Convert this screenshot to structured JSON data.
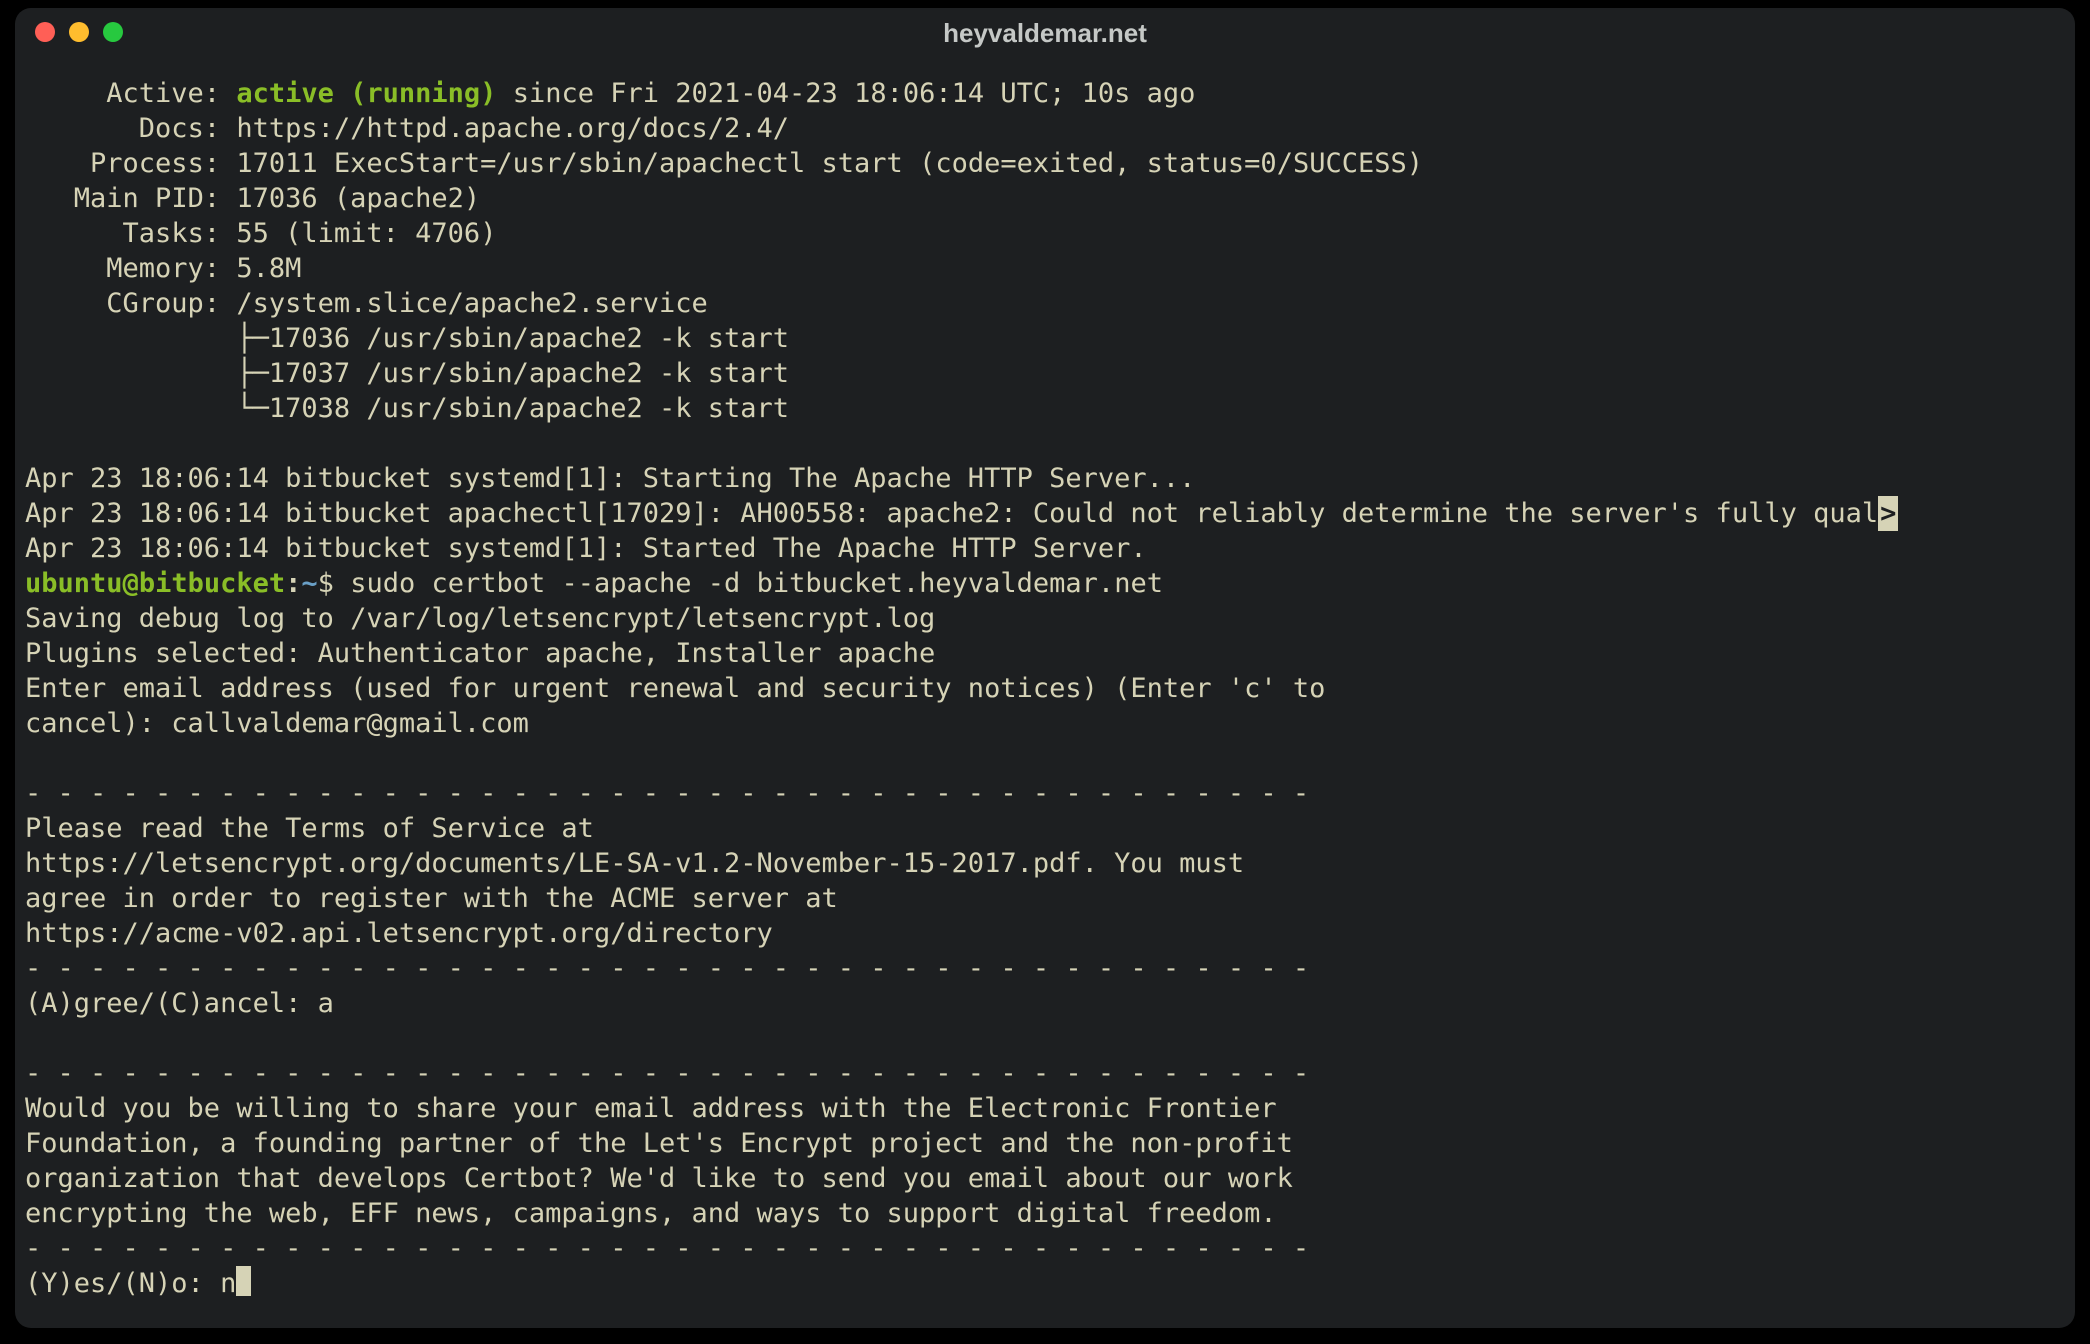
{
  "window": {
    "title": "heyvaldemar.net"
  },
  "status": {
    "active_label": "Active:",
    "active_value": "active (running)",
    "since": "since Fri 2021-04-23 18:06:14 UTC; 10s ago",
    "docs_label": "Docs:",
    "docs_value": "https://httpd.apache.org/docs/2.4/",
    "process_label": "Process:",
    "process_value": "17011 ExecStart=/usr/sbin/apachectl start (code=exited, status=0/SUCCESS)",
    "mainpid_label": "Main PID:",
    "mainpid_value": "17036 (apache2)",
    "tasks_label": "Tasks:",
    "tasks_value": "55 (limit: 4706)",
    "memory_label": "Memory:",
    "memory_value": "5.8M",
    "cgroup_label": "CGroup:",
    "cgroup_value": "/system.slice/apache2.service",
    "cgroup_tree1": "├─17036 /usr/sbin/apache2 -k start",
    "cgroup_tree2": "├─17037 /usr/sbin/apache2 -k start",
    "cgroup_tree3": "└─17038 /usr/sbin/apache2 -k start"
  },
  "log": {
    "l1": "Apr 23 18:06:14 bitbucket systemd[1]: Starting The Apache HTTP Server...",
    "l2": "Apr 23 18:06:14 bitbucket apachectl[17029]: AH00558: apache2: Could not reliably determine the server's fully qual",
    "l2_mark": ">",
    "l3": "Apr 23 18:06:14 bitbucket systemd[1]: Started The Apache HTTP Server."
  },
  "prompt": {
    "user": "ubuntu",
    "at": "@",
    "host": "bitbucket",
    "colon": ":",
    "path": "~",
    "dollar": "$",
    "command": "sudo certbot --apache -d bitbucket.heyvaldemar.net"
  },
  "certbot": {
    "c1": "Saving debug log to /var/log/letsencrypt/letsencrypt.log",
    "c2": "Plugins selected: Authenticator apache, Installer apache",
    "c3": "Enter email address (used for urgent renewal and security notices) (Enter 'c' to",
    "c4": "cancel): callvaldemar@gmail.com",
    "dash": "- - - - - - - - - - - - - - - - - - - - - - - - - - - - - - - - - - - - - - - -",
    "t1": "Please read the Terms of Service at",
    "t2": "https://letsencrypt.org/documents/LE-SA-v1.2-November-15-2017.pdf. You must",
    "t3": "agree in order to register with the ACME server at",
    "t4": "https://acme-v02.api.letsencrypt.org/directory",
    "agree_prompt": "(A)gree/(C)ancel: a",
    "e1": "Would you be willing to share your email address with the Electronic Frontier",
    "e2": "Foundation, a founding partner of the Let's Encrypt project and the non-profit",
    "e3": "organization that develops Certbot? We'd like to send you email about our work",
    "e4": "encrypting the web, EFF news, campaigns, and ways to support digital freedom.",
    "yesno_prompt": "(Y)es/(N)o: n"
  }
}
